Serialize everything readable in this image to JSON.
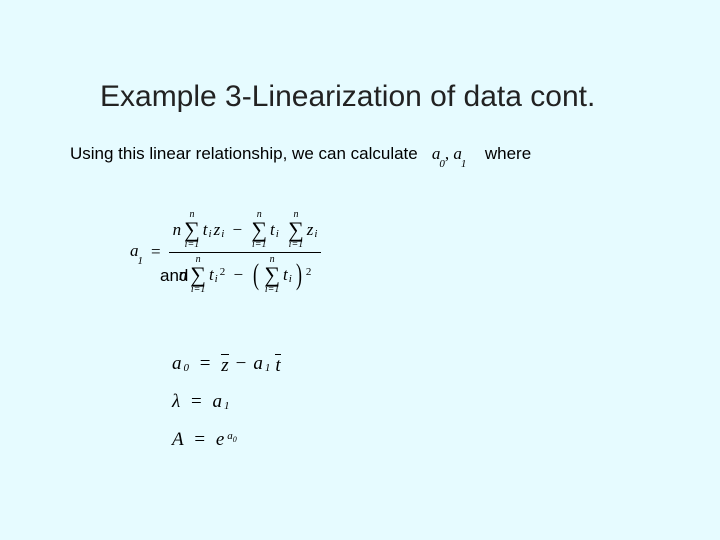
{
  "title": "Example 3-Linearization of data cont.",
  "line1_pre": "Using this linear relationship, we can calculate",
  "line1_vars": "a",
  "line1_sub0": "0",
  "line1_comma": ",",
  "line1_sub1": "1",
  "line1_post": "where",
  "and_label": "and",
  "math": {
    "a": "a",
    "eq": "=",
    "n": "n",
    "t": "t",
    "z": "z",
    "i": "i",
    "one": "1",
    "zero": "0",
    "two": "2",
    "minus": "−",
    "sum_top": "n",
    "sum_bot": "i=1",
    "sigma": "∑",
    "lparen": "(",
    "rparen": ")",
    "zbar": "z",
    "tbar": "t",
    "lambda": "λ",
    "A": "A",
    "e": "e",
    "sup_a0": "a",
    "sup_a0_sub": "0"
  }
}
